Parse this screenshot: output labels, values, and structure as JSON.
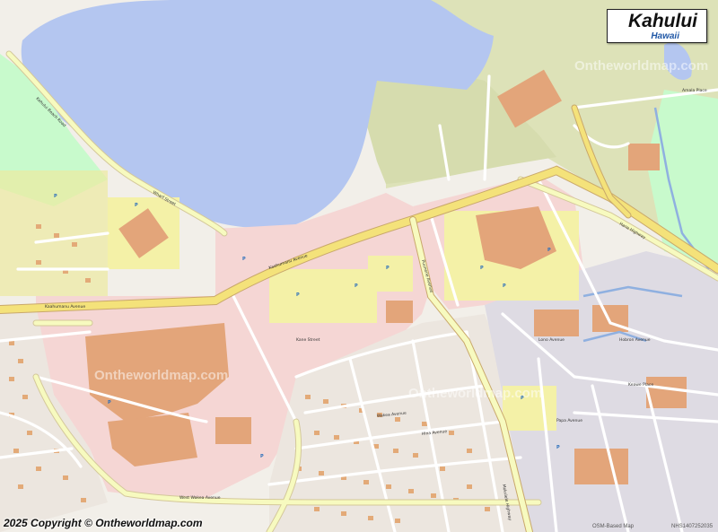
{
  "map": {
    "title": "Kahului",
    "subtitle": "Hawaii",
    "copyright": "2025 Copyright © Ontheworldmap.com",
    "osm_credit": "OSM-Based Map",
    "image_id": "NHS1407252035",
    "watermark": "Ontheworldmap.com",
    "colors": {
      "water": "#aad3df",
      "bay": "#b4c6f0",
      "land": "#f2efe9",
      "residential": "#e0dfdf",
      "commercial": "#f2dad9",
      "retail": "#ffd6d1",
      "industrial": "#ebdbe8",
      "parking": "#eeeeaa",
      "park": "#c8facc",
      "primary_road": "#fcd6a4",
      "trunk_road": "#f7fabf",
      "building": "#e3aa78",
      "port": "#d0d8a8"
    },
    "street_labels": {
      "kaahumanu": "Kaahumanu Avenue",
      "wakea": "Wakea Avenue",
      "puunene": "Puunene Avenue",
      "west_wakea": "West Wakea Avenue",
      "hina": "Hina Avenue",
      "kane": "Kane Street",
      "lono": "Lono Avenue",
      "papa": "Papa Avenue",
      "amala": "Amala Place",
      "kahului_beach": "Kahului Beach Road",
      "wharf": "Wharf Street",
      "hana": "Hana Highway",
      "kaahumanu_east": "Kaahumanu Avenue",
      "hobron": "Hobron Avenue",
      "keawe": "Keawe Place",
      "mokulele": "Mokulele Highway"
    }
  }
}
